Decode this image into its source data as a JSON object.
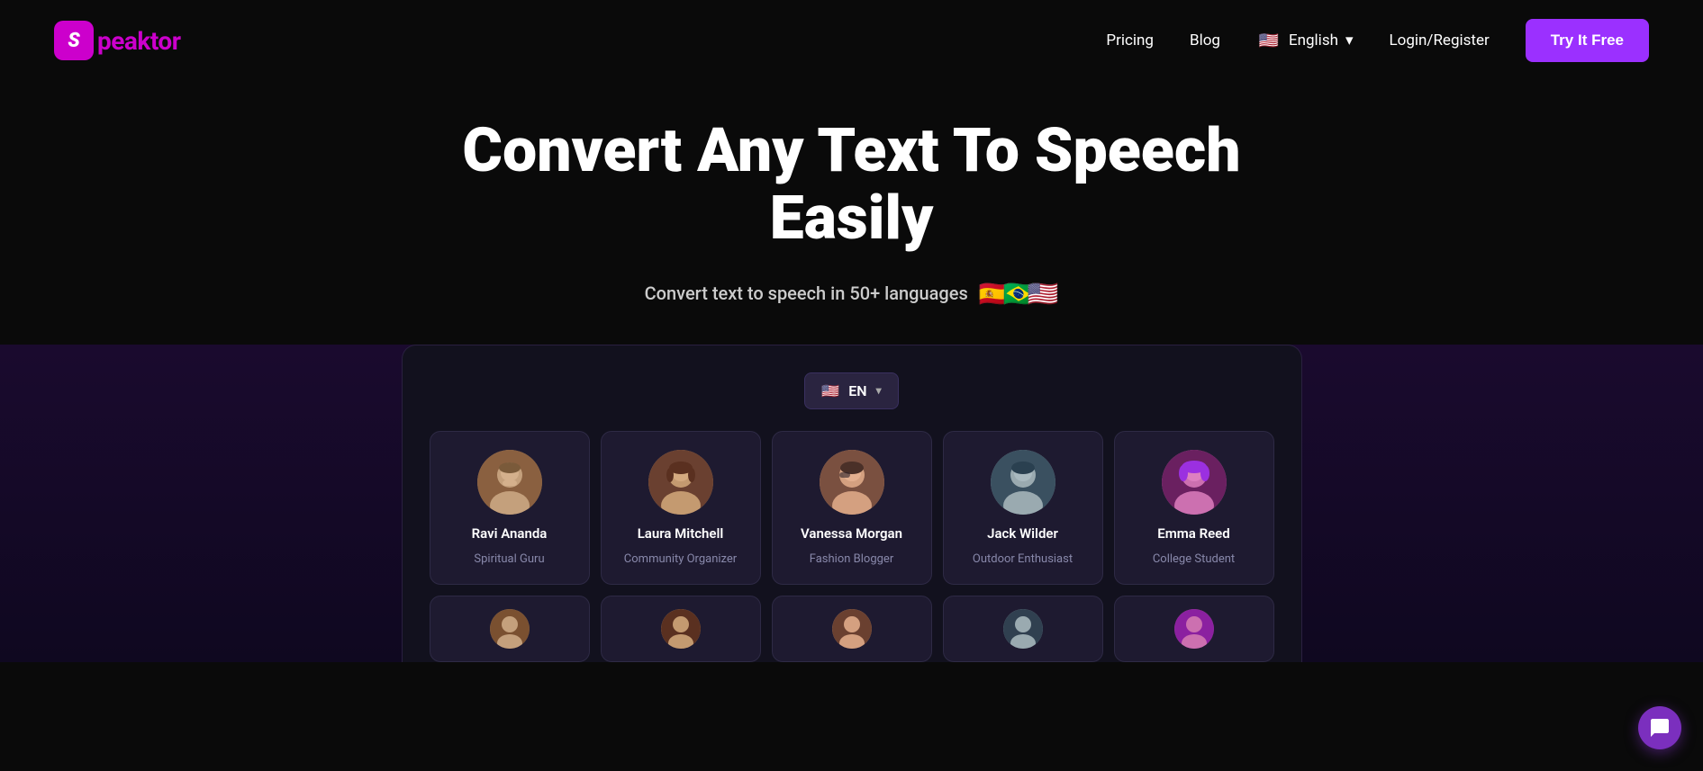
{
  "navbar": {
    "logo_letter": "S",
    "logo_name": "peaktor",
    "pricing_label": "Pricing",
    "blog_label": "Blog",
    "language_label": "English",
    "login_label": "Login/Register",
    "try_free_label": "Try It Free",
    "flag_emoji": "🇺🇸"
  },
  "hero": {
    "title": "Convert Any Text To Speech Easily",
    "subtitle": "Convert text to speech in 50+ languages",
    "flags": [
      "🇪🇸",
      "🇧🇷",
      "🇺🇸"
    ]
  },
  "panel": {
    "lang_selector": {
      "flag": "🇺🇸",
      "code": "EN"
    },
    "voices_row1": [
      {
        "name": "Ravi Ananda",
        "role": "Spiritual Guru",
        "avatar_class": "avatar-ravi",
        "emoji": "👴"
      },
      {
        "name": "Laura Mitchell",
        "role": "Community Organizer",
        "avatar_class": "avatar-laura",
        "emoji": "👩"
      },
      {
        "name": "Vanessa Morgan",
        "role": "Fashion Blogger",
        "avatar_class": "avatar-vanessa",
        "emoji": "🧑"
      },
      {
        "name": "Jack Wilder",
        "role": "Outdoor Enthusiast",
        "avatar_class": "avatar-jack",
        "emoji": "👨"
      },
      {
        "name": "Emma Reed",
        "role": "College Student",
        "avatar_class": "avatar-emma",
        "emoji": "👩"
      }
    ],
    "voices_row2": [
      {
        "name": "",
        "role": "",
        "avatar_class": "avatar-ravi",
        "emoji": "🧔"
      },
      {
        "name": "",
        "role": "",
        "avatar_class": "avatar-laura",
        "emoji": "👩"
      },
      {
        "name": "",
        "role": "",
        "avatar_class": "avatar-vanessa",
        "emoji": "👩"
      },
      {
        "name": "",
        "role": "",
        "avatar_class": "avatar-jack",
        "emoji": "👨"
      },
      {
        "name": "",
        "role": "",
        "avatar_class": "avatar-emma",
        "emoji": "👱"
      }
    ]
  }
}
